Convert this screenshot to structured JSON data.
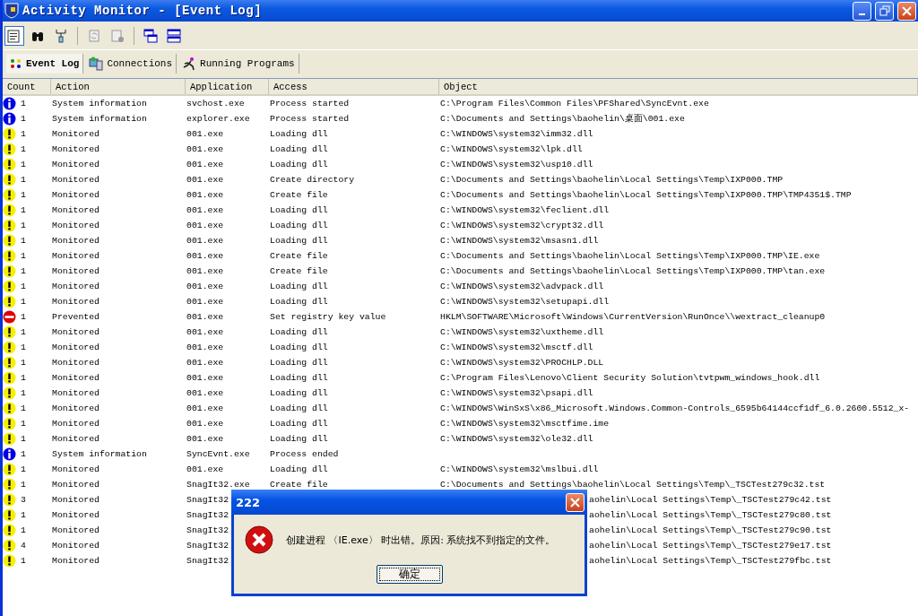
{
  "window": {
    "title": "Activity Monitor - [Event Log]"
  },
  "toolbar": [
    {
      "kind": "properties",
      "selected": true
    },
    {
      "kind": "find",
      "selected": false
    },
    {
      "kind": "network",
      "selected": false
    },
    {
      "kind": "refresh",
      "selected": false
    },
    {
      "kind": "settings",
      "selected": false
    },
    {
      "kind": "cascade",
      "selected": false
    },
    {
      "kind": "tile",
      "selected": false
    }
  ],
  "tabs": [
    {
      "label": "Event Log",
      "kind": "dots",
      "selected": true
    },
    {
      "label": "Connections",
      "kind": "network",
      "selected": false
    },
    {
      "label": "Running Programs",
      "kind": "runner",
      "selected": false
    }
  ],
  "table": {
    "columns": [
      "Count",
      "Action",
      "Application",
      "Access",
      "Object"
    ],
    "rows": [
      {
        "kind": "info",
        "count": "1",
        "action": "System information",
        "application": "svchost.exe",
        "access": "Process started",
        "object": "C:\\Program Files\\Common Files\\PFShared\\SyncEvnt.exe"
      },
      {
        "kind": "info",
        "count": "1",
        "action": "System information",
        "application": "explorer.exe",
        "access": "Process started",
        "object": "C:\\Documents and Settings\\baohelin\\桌面\\001.exe"
      },
      {
        "kind": "warning",
        "count": "1",
        "action": "Monitored",
        "application": "001.exe",
        "access": "Loading dll",
        "object": "C:\\WINDOWS\\system32\\imm32.dll"
      },
      {
        "kind": "warning",
        "count": "1",
        "action": "Monitored",
        "application": "001.exe",
        "access": "Loading dll",
        "object": "C:\\WINDOWS\\system32\\lpk.dll"
      },
      {
        "kind": "warning",
        "count": "1",
        "action": "Monitored",
        "application": "001.exe",
        "access": "Loading dll",
        "object": "C:\\WINDOWS\\system32\\usp10.dll"
      },
      {
        "kind": "warning",
        "count": "1",
        "action": "Monitored",
        "application": "001.exe",
        "access": "Create directory",
        "object": "C:\\Documents and Settings\\baohelin\\Local Settings\\Temp\\IXP000.TMP"
      },
      {
        "kind": "warning",
        "count": "1",
        "action": "Monitored",
        "application": "001.exe",
        "access": "Create file",
        "object": "C:\\Documents and Settings\\baohelin\\Local Settings\\Temp\\IXP000.TMP\\TMP4351$.TMP"
      },
      {
        "kind": "warning",
        "count": "1",
        "action": "Monitored",
        "application": "001.exe",
        "access": "Loading dll",
        "object": "C:\\WINDOWS\\system32\\feclient.dll"
      },
      {
        "kind": "warning",
        "count": "1",
        "action": "Monitored",
        "application": "001.exe",
        "access": "Loading dll",
        "object": "C:\\WINDOWS\\system32\\crypt32.dll"
      },
      {
        "kind": "warning",
        "count": "1",
        "action": "Monitored",
        "application": "001.exe",
        "access": "Loading dll",
        "object": "C:\\WINDOWS\\system32\\msasn1.dll"
      },
      {
        "kind": "warning",
        "count": "1",
        "action": "Monitored",
        "application": "001.exe",
        "access": "Create file",
        "object": "C:\\Documents and Settings\\baohelin\\Local Settings\\Temp\\IXP000.TMP\\IE.exe"
      },
      {
        "kind": "warning",
        "count": "1",
        "action": "Monitored",
        "application": "001.exe",
        "access": "Create file",
        "object": "C:\\Documents and Settings\\baohelin\\Local Settings\\Temp\\IXP000.TMP\\tan.exe"
      },
      {
        "kind": "warning",
        "count": "1",
        "action": "Monitored",
        "application": "001.exe",
        "access": "Loading dll",
        "object": "C:\\WINDOWS\\system32\\advpack.dll"
      },
      {
        "kind": "warning",
        "count": "1",
        "action": "Monitored",
        "application": "001.exe",
        "access": "Loading dll",
        "object": "C:\\WINDOWS\\system32\\setupapi.dll"
      },
      {
        "kind": "prevented",
        "count": "1",
        "action": "Prevented",
        "application": "001.exe",
        "access": "Set registry key value",
        "object": "HKLM\\SOFTWARE\\Microsoft\\Windows\\CurrentVersion\\RunOnce\\\\wextract_cleanup0"
      },
      {
        "kind": "warning",
        "count": "1",
        "action": "Monitored",
        "application": "001.exe",
        "access": "Loading dll",
        "object": "C:\\WINDOWS\\system32\\uxtheme.dll"
      },
      {
        "kind": "warning",
        "count": "1",
        "action": "Monitored",
        "application": "001.exe",
        "access": "Loading dll",
        "object": "C:\\WINDOWS\\system32\\msctf.dll"
      },
      {
        "kind": "warning",
        "count": "1",
        "action": "Monitored",
        "application": "001.exe",
        "access": "Loading dll",
        "object": "C:\\WINDOWS\\system32\\PROCHLP.DLL"
      },
      {
        "kind": "warning",
        "count": "1",
        "action": "Monitored",
        "application": "001.exe",
        "access": "Loading dll",
        "object": "C:\\Program Files\\Lenovo\\Client Security Solution\\tvtpwm_windows_hook.dll"
      },
      {
        "kind": "warning",
        "count": "1",
        "action": "Monitored",
        "application": "001.exe",
        "access": "Loading dll",
        "object": "C:\\WINDOWS\\system32\\psapi.dll"
      },
      {
        "kind": "warning",
        "count": "1",
        "action": "Monitored",
        "application": "001.exe",
        "access": "Loading dll",
        "object": "C:\\WINDOWS\\WinSxS\\x86_Microsoft.Windows.Common-Controls_6595b64144ccf1df_6.0.2600.5512_x-"
      },
      {
        "kind": "warning",
        "count": "1",
        "action": "Monitored",
        "application": "001.exe",
        "access": "Loading dll",
        "object": "C:\\WINDOWS\\system32\\msctfime.ime"
      },
      {
        "kind": "warning",
        "count": "1",
        "action": "Monitored",
        "application": "001.exe",
        "access": "Loading dll",
        "object": "C:\\WINDOWS\\system32\\ole32.dll"
      },
      {
        "kind": "info",
        "count": "1",
        "action": "System information",
        "application": "SyncEvnt.exe",
        "access": "Process ended"
      },
      {
        "kind": "warning",
        "count": "1",
        "action": "Monitored",
        "application": "001.exe",
        "access": "Loading dll",
        "object": "C:\\WINDOWS\\system32\\mslbui.dll"
      },
      {
        "kind": "warning",
        "count": "1",
        "action": "Monitored",
        "application": "SnagIt32.exe",
        "access": "Create file",
        "object": "C:\\Documents and Settings\\baohelin\\Local Settings\\Temp\\_TSCTest279c32.tst"
      },
      {
        "kind": "warning",
        "covered": true,
        "count": "3",
        "action": "Monitored",
        "application": "SnagIt32",
        "object": "aohelin\\Local Settings\\Temp\\_TSCTest279c42.tst"
      },
      {
        "kind": "warning",
        "covered": true,
        "count": "1",
        "action": "Monitored",
        "application": "SnagIt32",
        "object": "aohelin\\Local Settings\\Temp\\_TSCTest279c80.tst"
      },
      {
        "kind": "warning",
        "covered": true,
        "count": "1",
        "action": "Monitored",
        "application": "SnagIt32",
        "object": "aohelin\\Local Settings\\Temp\\_TSCTest279c90.tst"
      },
      {
        "kind": "warning",
        "covered": true,
        "count": "4",
        "action": "Monitored",
        "application": "SnagIt32",
        "object": "aohelin\\Local Settings\\Temp\\_TSCTest279e17.tst"
      },
      {
        "kind": "warning",
        "covered": true,
        "count": "1",
        "action": "Monitored",
        "application": "SnagIt32",
        "object": "aohelin\\Local Settings\\Temp\\_TSCTest279fbc.tst"
      }
    ]
  },
  "dialog": {
    "title": "222",
    "message": "创建进程 〈IE.exe〉 时出错。原因: 系统找不到指定的文件。",
    "button": "确定"
  }
}
